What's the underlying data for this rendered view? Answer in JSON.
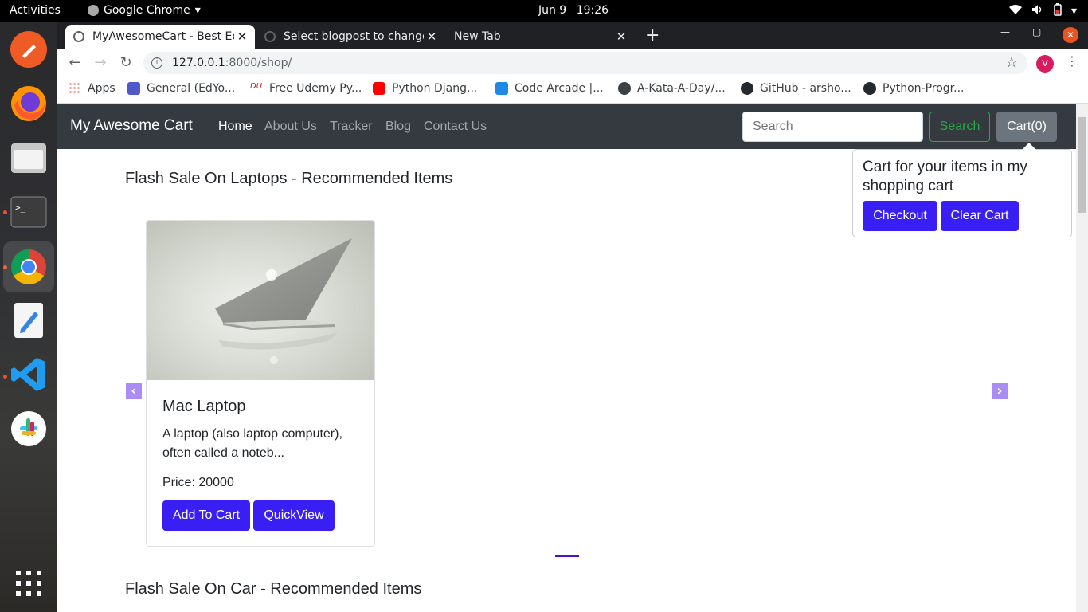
{
  "system": {
    "activities": "Activities",
    "app_name": "Google Chrome",
    "date": "Jun 9",
    "time": "19:26"
  },
  "browser": {
    "tabs": [
      {
        "title": "MyAwesomeCart - Best Ec",
        "active": true
      },
      {
        "title": "Select blogpost to change",
        "active": false
      },
      {
        "title": "New Tab",
        "active": false
      }
    ],
    "url_host": "127.0.0.1",
    "url_path": ":8000/shop/",
    "profile_initial": "V",
    "bookmarks": [
      {
        "label": "Apps",
        "icon": "apps-grid-icon"
      },
      {
        "label": "General (EdYo...",
        "icon": "teams-icon"
      },
      {
        "label": "Free Udemy Py...",
        "icon": "udemy-icon"
      },
      {
        "label": "Python Djang...",
        "icon": "youtube-icon"
      },
      {
        "label": "Code Arcade |...",
        "icon": "code-arcade-icon"
      },
      {
        "label": "A-Kata-A-Day/...",
        "icon": "globe-icon"
      },
      {
        "label": "GitHub - arsho...",
        "icon": "github-icon"
      },
      {
        "label": "Python-Progr...",
        "icon": "github-icon"
      }
    ]
  },
  "site": {
    "brand": "My Awesome Cart",
    "nav": [
      "Home",
      "About Us",
      "Tracker",
      "Blog",
      "Contact Us"
    ],
    "search_placeholder": "Search",
    "search_button": "Search",
    "cart_button": "Cart(0)",
    "popover": {
      "text": "Cart for your items in my shopping cart",
      "checkout": "Checkout",
      "clear": "Clear Cart"
    },
    "sections": [
      {
        "title": "Flash Sale On Laptops - Recommended Items"
      },
      {
        "title": "Flash Sale On Car - Recommended Items"
      }
    ],
    "product": {
      "title": "Mac Laptop",
      "description": "A laptop (also laptop computer), often called a noteb...",
      "price": "Price: 20000",
      "add_to_cart": "Add To Cart",
      "quickview": "QuickView"
    }
  },
  "colors": {
    "navbar": "#343a40",
    "primary_button": "#3a1ff5",
    "search_green": "#28a745",
    "cart_gray": "#6c757d",
    "carousel_control": "#a98cf5"
  }
}
